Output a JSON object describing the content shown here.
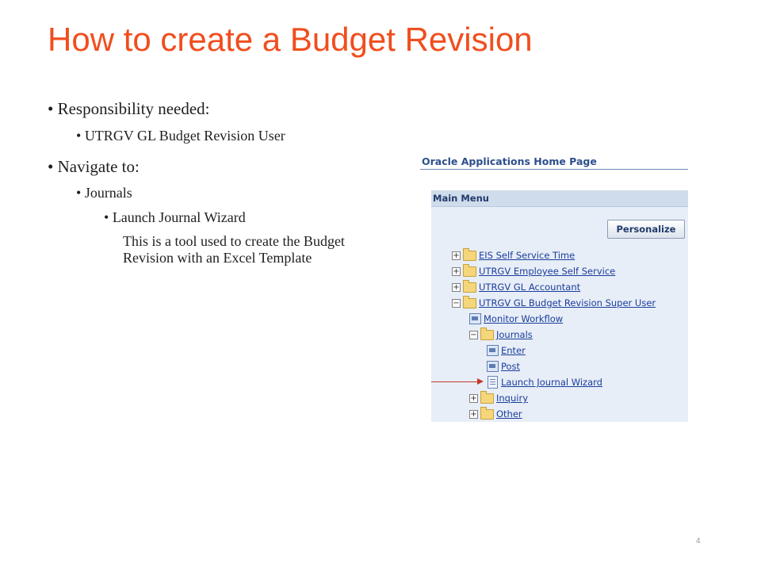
{
  "slide": {
    "title": "How to create a Budget Revision",
    "bullets": {
      "responsibility": "Responsibility needed:",
      "responsibility_value": "UTRGV GL Budget Revision User",
      "navigate": "Navigate to:",
      "journals": "Journals",
      "wizard": "Launch Journal Wizard",
      "description": "This is a tool used to create the Budget Revision with an Excel Template"
    },
    "page_number": "4"
  },
  "screenshot": {
    "home_title": "Oracle Applications Home Page",
    "menu_header": "Main Menu",
    "personalize_label": "Personalize",
    "tree": [
      {
        "label": "EIS Self Service Time",
        "toggle": "+"
      },
      {
        "label": "UTRGV Employee Self Service",
        "toggle": "+"
      },
      {
        "label": "UTRGV GL Accountant",
        "toggle": "+"
      },
      {
        "label": "UTRGV GL Budget Revision Super User",
        "toggle": "−"
      },
      {
        "label": "Monitor Workflow"
      },
      {
        "label": "Journals",
        "toggle": "−"
      },
      {
        "label": "Enter"
      },
      {
        "label": "Post"
      },
      {
        "label": "Launch Journal Wizard"
      },
      {
        "label": "Inquiry",
        "toggle": "+"
      },
      {
        "label": "Other",
        "toggle": "+"
      }
    ]
  },
  "colors": {
    "title": "#f04e1e",
    "link": "#1a3d9c",
    "arrow": "#c0392b"
  }
}
